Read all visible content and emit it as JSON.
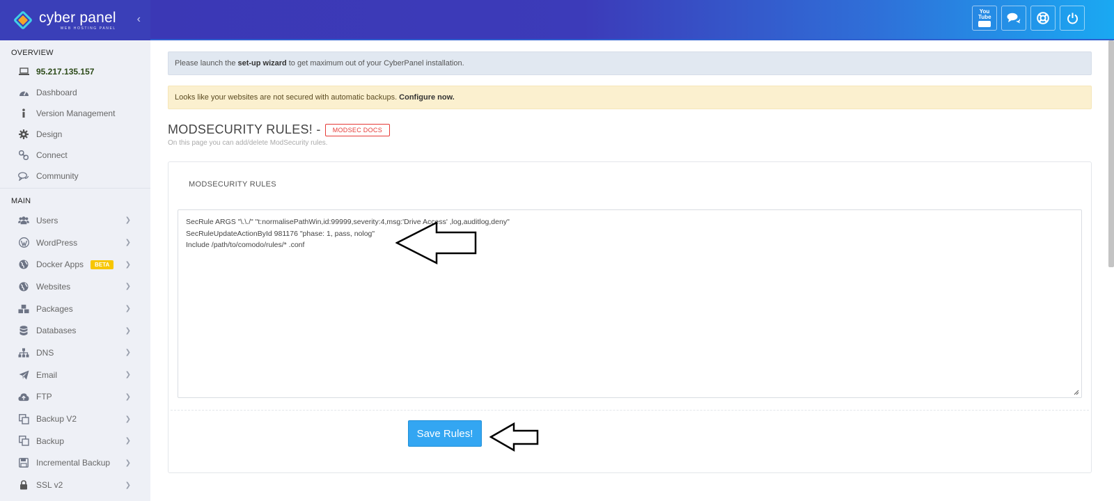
{
  "brand": {
    "name": "cyber panel",
    "subtitle": "WEB HOSTING PANEL"
  },
  "sidebar": {
    "overview_label": "OVERVIEW",
    "overview_items": [
      {
        "label": "95.217.135.157",
        "icon": "laptop-icon"
      },
      {
        "label": "Dashboard",
        "icon": "dashboard-icon"
      },
      {
        "label": "Version Management",
        "icon": "info-icon"
      },
      {
        "label": "Design",
        "icon": "gear-icon"
      },
      {
        "label": "Connect",
        "icon": "link-icon"
      },
      {
        "label": "Community",
        "icon": "chat-icon"
      }
    ],
    "main_label": "MAIN",
    "main_items": [
      {
        "label": "Users",
        "icon": "users-icon"
      },
      {
        "label": "WordPress",
        "icon": "wordpress-icon"
      },
      {
        "label": "Docker Apps",
        "icon": "globe-icon",
        "badge": "BETA"
      },
      {
        "label": "Websites",
        "icon": "globe-icon"
      },
      {
        "label": "Packages",
        "icon": "cubes-icon"
      },
      {
        "label": "Databases",
        "icon": "database-icon"
      },
      {
        "label": "DNS",
        "icon": "sitemap-icon"
      },
      {
        "label": "Email",
        "icon": "paper-plane-icon"
      },
      {
        "label": "FTP",
        "icon": "cloud-upload-icon"
      },
      {
        "label": "Backup V2",
        "icon": "copy-icon"
      },
      {
        "label": "Backup",
        "icon": "copy-icon"
      },
      {
        "label": "Incremental Backup",
        "icon": "save-icon"
      },
      {
        "label": "SSL v2",
        "icon": "lock-icon"
      }
    ]
  },
  "topbar": {
    "actions": [
      {
        "icon": "youtube-icon",
        "label": "You Tube"
      },
      {
        "icon": "chat-bubbles-icon"
      },
      {
        "icon": "support-icon"
      },
      {
        "icon": "power-icon"
      }
    ]
  },
  "alerts": {
    "wizard_pre": "Please launch the",
    "wizard_link": "set-up wizard",
    "wizard_post": "to get maximum out of your CyberPanel installation.",
    "backup_pre": "Looks like your websites are not secured with automatic backups.",
    "backup_link": "Configure now."
  },
  "page": {
    "title": "MODSECURITY RULES! -",
    "docs_label": "MODSEC DOCS",
    "subtitle": "On this page you can add/delete ModSecurity rules."
  },
  "panel": {
    "title": "MODSECURITY RULES",
    "rules_lines": [
      "SecRule ARGS \"\\.\\./\" \"t:normalisePathWin,id:99999,severity:4,msg:'Drive Access' ,log,auditlog,deny\"",
      "SecRuleUpdateActionById 981176 \"phase: 1, pass, nolog\"",
      "Include /path/to/comodo/rules/* .conf"
    ],
    "save_label": "Save Rules!"
  }
}
